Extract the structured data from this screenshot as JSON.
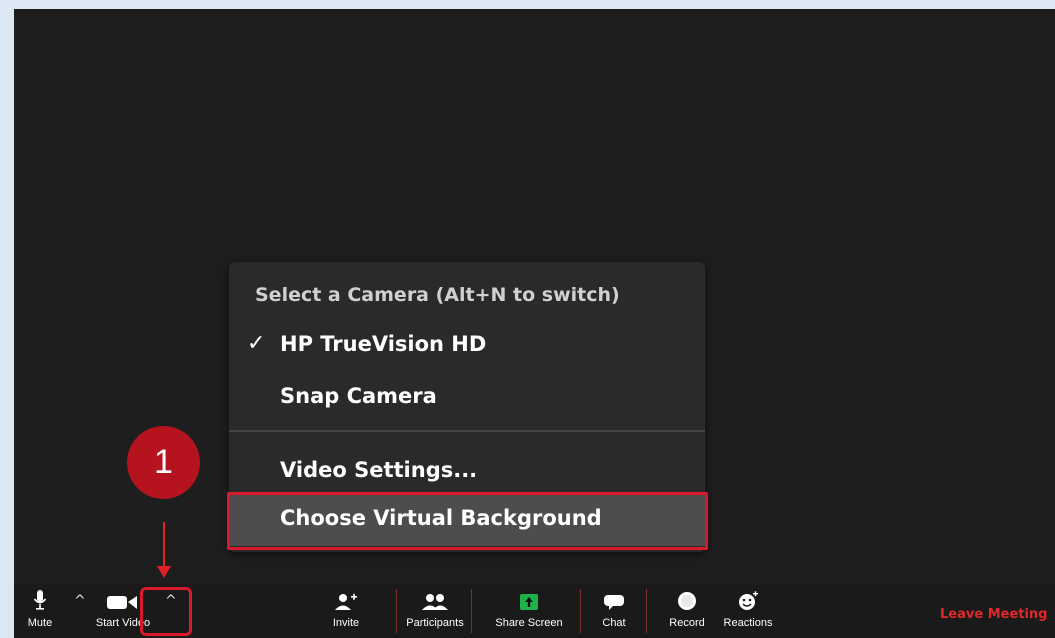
{
  "camera_menu": {
    "header": "Select a Camera (Alt+N to switch)",
    "items": [
      {
        "label": "HP TrueVision HD",
        "checked": true,
        "check_glyph": "✓"
      },
      {
        "label": "Snap Camera",
        "checked": false
      },
      {
        "label": "Video Settings..."
      },
      {
        "label": "Choose Virtual Background",
        "highlighted": true
      }
    ]
  },
  "annotation": {
    "step_number": "1",
    "highlight_color": "#d9192c"
  },
  "toolbar": {
    "mute_label": "Mute",
    "start_video_label": "Start Video",
    "invite_label": "Invite",
    "participants_label": "Participants",
    "share_screen_label": "Share Screen",
    "chat_label": "Chat",
    "record_label": "Record",
    "reactions_label": "Reactions",
    "leave_label": "Leave Meeting",
    "caret_glyph": "^",
    "share_accent": "#1fb24a"
  }
}
